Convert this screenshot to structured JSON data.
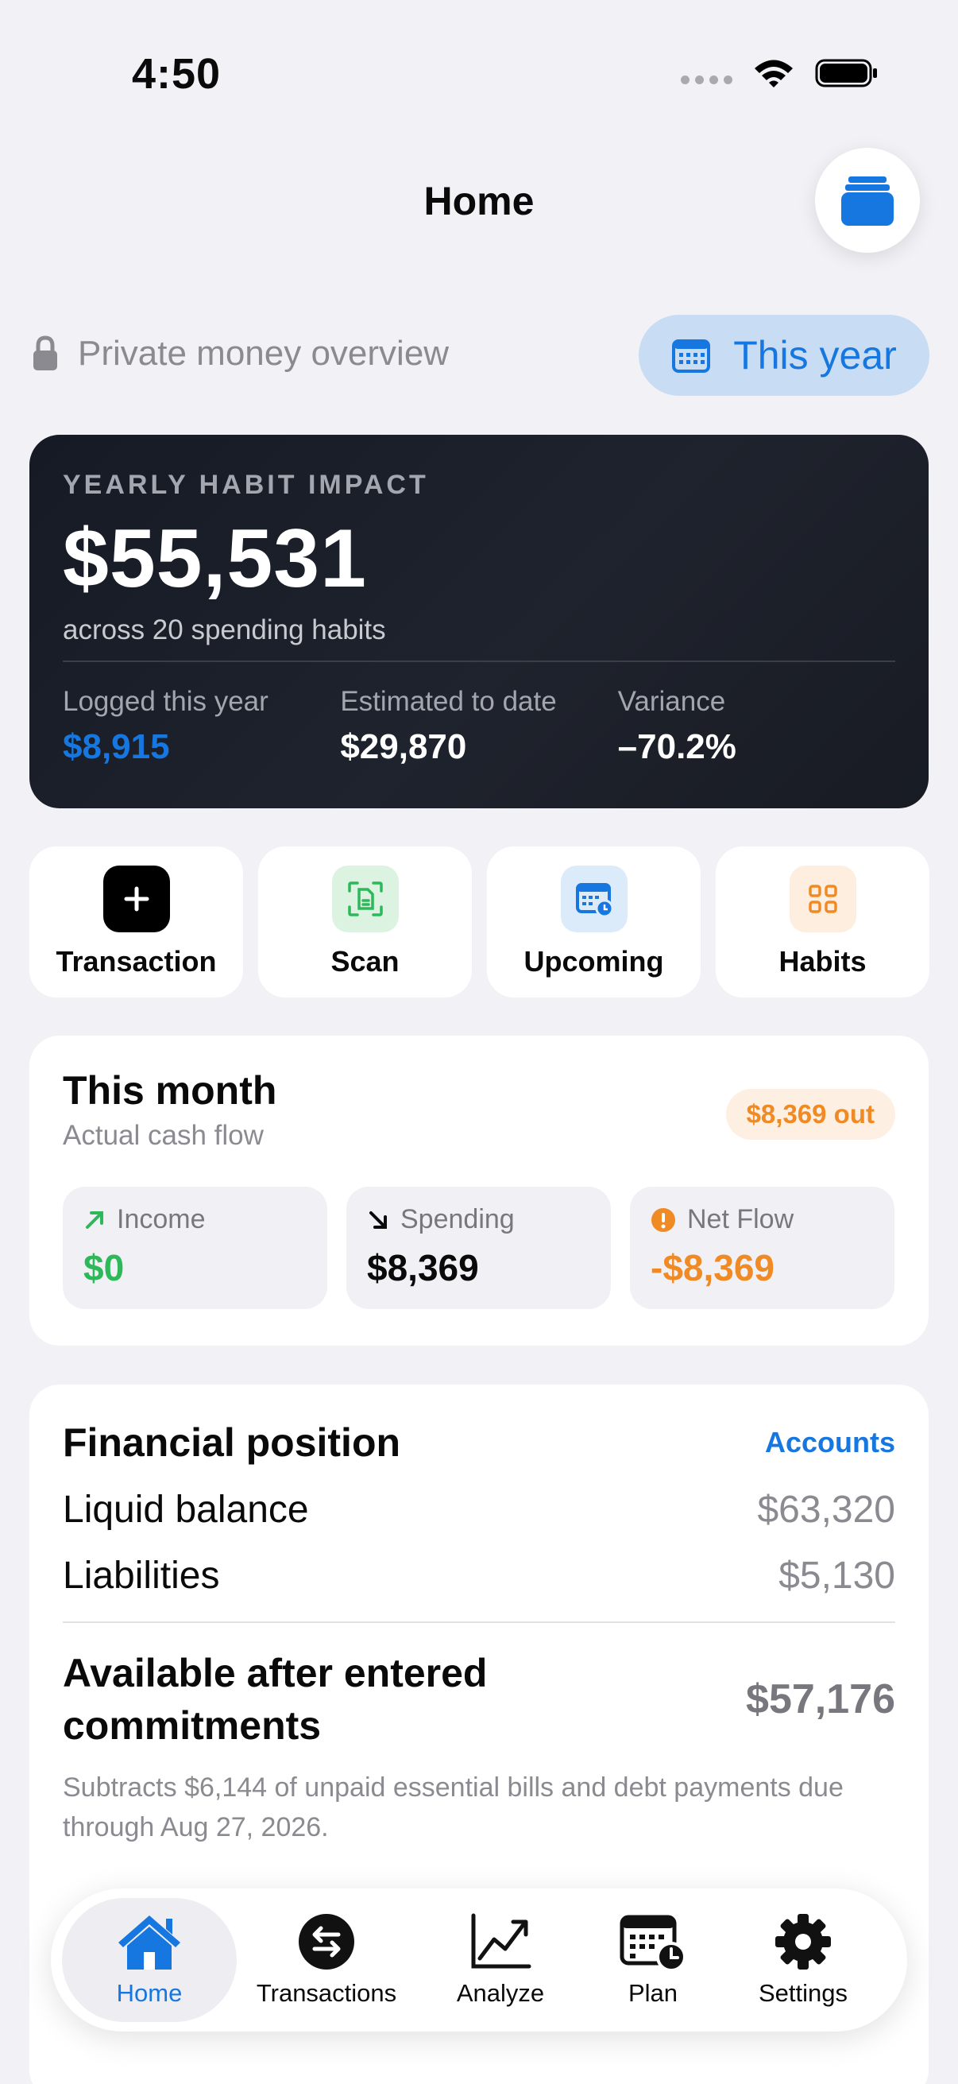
{
  "status_bar": {
    "time": "4:50"
  },
  "header": {
    "title": "Home"
  },
  "privacy": {
    "label": "Private money overview",
    "period": "This year"
  },
  "hero": {
    "label": "YEARLY HABIT IMPACT",
    "value": "$55,531",
    "subtitle": "across 20 spending habits",
    "stats": [
      {
        "label": "Logged this year",
        "value": "$8,915"
      },
      {
        "label": "Estimated to date",
        "value": "$29,870"
      },
      {
        "label": "Variance",
        "value": "–70.2%"
      }
    ]
  },
  "actions": [
    {
      "label": "Transaction",
      "icon": "plus-icon"
    },
    {
      "label": "Scan",
      "icon": "scan-document-icon"
    },
    {
      "label": "Upcoming",
      "icon": "calendar-clock-icon"
    },
    {
      "label": "Habits",
      "icon": "grid-icon"
    }
  ],
  "month": {
    "title": "This month",
    "subtitle": "Actual cash flow",
    "badge": "$8,369 out",
    "tiles": [
      {
        "label": "Income",
        "value": "$0",
        "icon": "arrow-up-right-icon",
        "color": "#2DB85A"
      },
      {
        "label": "Spending",
        "value": "$8,369",
        "icon": "arrow-down-right-icon",
        "color": "#0A0A0A"
      },
      {
        "label": "Net Flow",
        "value": "-$8,369",
        "icon": "warning-icon",
        "color": "#F08A24"
      }
    ]
  },
  "financial": {
    "title": "Financial position",
    "link": "Accounts",
    "rows": [
      {
        "label": "Liquid balance",
        "value": "$63,320"
      },
      {
        "label": "Liabilities",
        "value": "$5,130"
      }
    ],
    "available_label": "Available after entered commitments",
    "available_value": "$57,176",
    "note": "Subtracts $6,144 of unpaid essential bills and debt payments due through Aug 27, 2026."
  },
  "tabbar": {
    "items": [
      {
        "label": "Home",
        "icon": "house-icon",
        "selected": true
      },
      {
        "label": "Transactions",
        "icon": "arrows-exchange-icon"
      },
      {
        "label": "Analyze",
        "icon": "line-chart-icon"
      },
      {
        "label": "Plan",
        "icon": "calendar-clock-icon"
      },
      {
        "label": "Settings",
        "icon": "gear-icon"
      }
    ]
  },
  "colors": {
    "accent": "#1677E0",
    "income": "#2DB85A",
    "warning": "#F08A24",
    "hero_bg": "#1B1F29"
  }
}
